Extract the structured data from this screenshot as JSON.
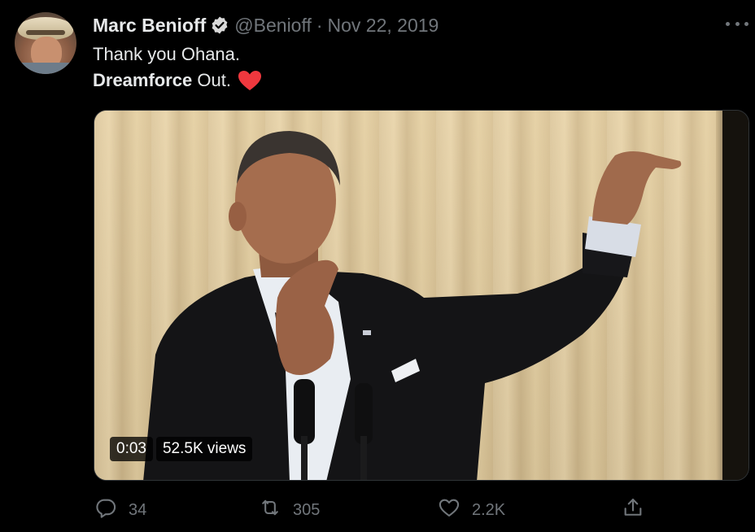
{
  "tweet": {
    "author_name": "Marc Benioff",
    "handle": "@Benioff",
    "separator": "·",
    "date": "Nov 22, 2019",
    "text_line1": "Thank you Ohana.",
    "text_line2_bold": "Dreamforce",
    "text_line2_rest": " Out."
  },
  "media": {
    "duration": "0:03",
    "views": "52.5K views"
  },
  "actions": {
    "replies": "34",
    "retweets": "305",
    "likes": "2.2K"
  },
  "icons": {
    "verified": "verified-badge-icon",
    "heart": "red-heart-emoji",
    "more": "more-options-icon",
    "reply": "reply-icon",
    "retweet": "retweet-icon",
    "like": "like-icon",
    "share": "share-icon"
  },
  "colors": {
    "background": "#000000",
    "text": "#e7e9ea",
    "muted": "#71767b",
    "heart": "#f0383e"
  }
}
